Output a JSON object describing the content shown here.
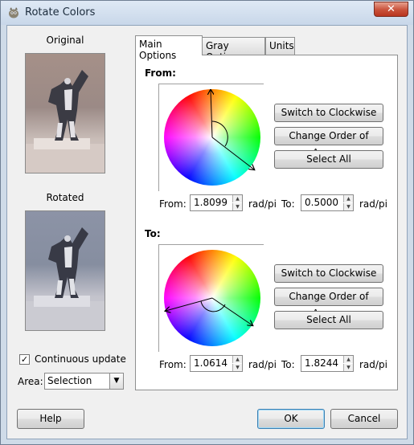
{
  "window": {
    "title": "Rotate Colors",
    "close_glyph": "✕"
  },
  "preview": {
    "original_label": "Original",
    "rotated_label": "Rotated"
  },
  "options": {
    "continuous_update_label": "Continuous update",
    "continuous_update_checked": true,
    "check_glyph": "✓",
    "area_label": "Area:",
    "area_value": "Selection"
  },
  "tabs": [
    {
      "label": "Main Options",
      "active": true
    },
    {
      "label": "Gray Options",
      "active": false
    },
    {
      "label": "Units",
      "active": false
    }
  ],
  "from_section": {
    "title": "From:",
    "buttons": {
      "switch": "Switch to Clockwise",
      "order": "Change Order of Arrows",
      "select_all": "Select All"
    },
    "from_label": "From:",
    "from_value": "1.8099",
    "to_label": "To:",
    "to_value": "0.5000",
    "unit": "rad/pi"
  },
  "to_section": {
    "title": "To:",
    "buttons": {
      "switch": "Switch to Clockwise",
      "order": "Change Order of Arrows",
      "select_all": "Select All"
    },
    "from_label": "From:",
    "from_value": "1.0614",
    "to_label": "To:",
    "to_value": "1.8244",
    "unit": "rad/pi"
  },
  "footer": {
    "help": "Help",
    "ok": "OK",
    "cancel": "Cancel"
  },
  "icons": {
    "app": "gimp-icon",
    "close": "close-icon",
    "dropdown": "chevron-down-icon",
    "spin_up": "spin-up-icon",
    "spin_down": "spin-down-icon"
  }
}
